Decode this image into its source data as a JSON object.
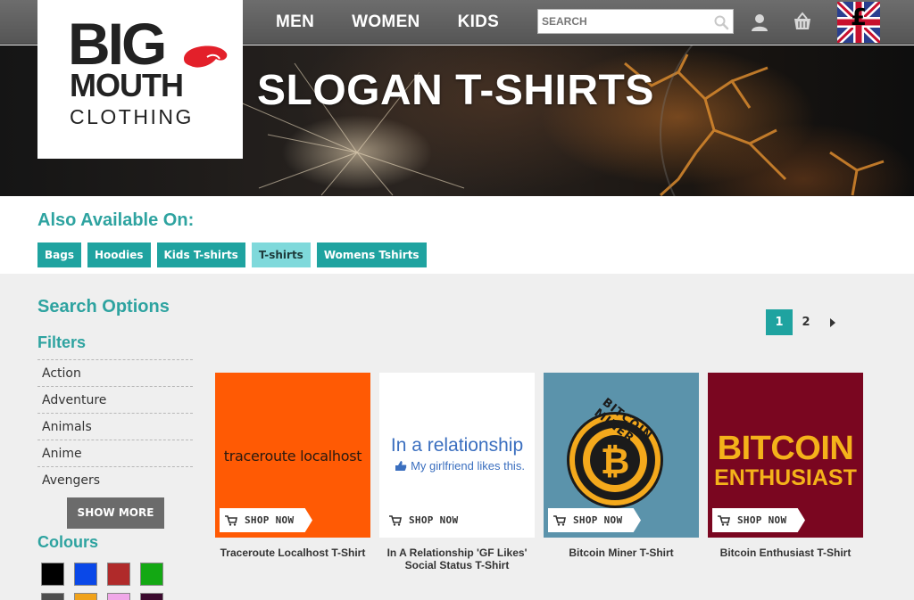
{
  "nav": {
    "items": [
      {
        "label": "MEN"
      },
      {
        "label": "WOMEN"
      },
      {
        "label": "KIDS"
      }
    ],
    "search_placeholder": "SEARCH",
    "currency_symbol": "£"
  },
  "logo": {
    "line1": "BIG",
    "line2": "MOUTH",
    "line3": "CLOTHING"
  },
  "banner": {
    "title": "SLOGAN T-SHIRTS"
  },
  "also_available": {
    "heading": "Also Available On:",
    "chips": [
      {
        "label": "Bags",
        "active": false
      },
      {
        "label": "Hoodies",
        "active": false
      },
      {
        "label": "Kids T-shirts",
        "active": false
      },
      {
        "label": "T-shirts",
        "active": true
      },
      {
        "label": "Womens Tshirts",
        "active": false
      }
    ]
  },
  "sidebar": {
    "title": "Search Options",
    "filters_title": "Filters",
    "filters": [
      "Action",
      "Adventure",
      "Animals",
      "Anime",
      "Avengers"
    ],
    "show_more_label": "SHOW MORE",
    "colours_title": "Colours",
    "colours": [
      "#000000",
      "#0a48e8",
      "#b02a2a",
      "#13a813",
      "#4d4d4d",
      "#f0a21a",
      "#f0a8e8",
      "#3b0a2e"
    ]
  },
  "pagination": {
    "pages": [
      "1",
      "2"
    ],
    "current": "1"
  },
  "products": [
    {
      "name": "Traceroute Localhost T-Shirt",
      "design_text": "traceroute localhost",
      "bg": "#ff5a04",
      "shop_label": "SHOP NOW"
    },
    {
      "name": "In A Relationship 'GF Likes' Social Status T-Shirt",
      "design_text": "In a relationship",
      "design_subtext": "My girlfriend likes this.",
      "bg": "#ffffff",
      "shop_label": "SHOP NOW"
    },
    {
      "name": "Bitcoin Miner T-Shirt",
      "design_text": "BITCOIN MINER",
      "bg": "#5b93ab",
      "shop_label": "SHOP NOW"
    },
    {
      "name": "Bitcoin Enthusiast T-Shirt",
      "design_text": "BITCOIN",
      "design_subtext": "ENTHUSIAST",
      "bg": "#7a0620",
      "shop_label": "SHOP NOW"
    }
  ]
}
